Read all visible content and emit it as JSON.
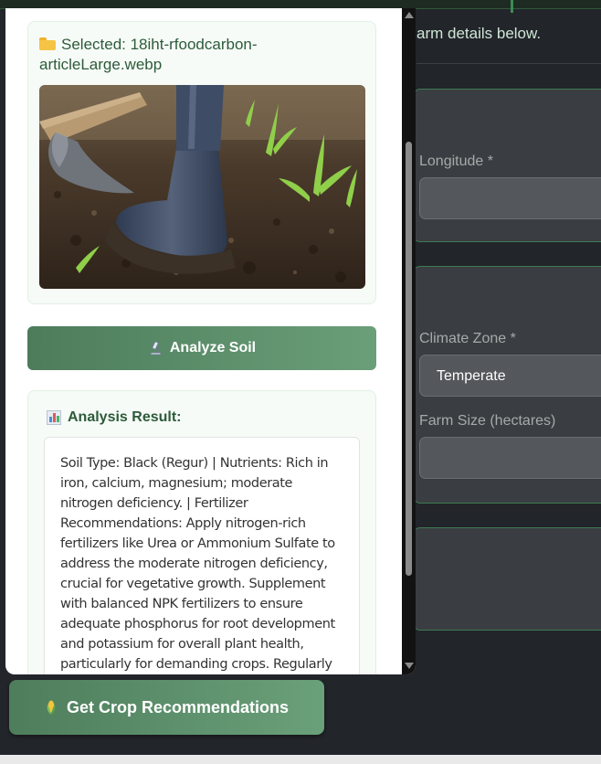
{
  "background_page": {
    "subtitle": "arm details below.",
    "fields": {
      "longitude_label": "Longitude *",
      "longitude_value": "",
      "climate_zone_label": "Climate Zone *",
      "climate_zone_value": "Temperate",
      "farm_size_label": "Farm Size (hectares)",
      "farm_size_value": ""
    },
    "get_crops_button": {
      "icon": "corn-icon",
      "label": "Get Crop Recommendations"
    }
  },
  "soil_modal": {
    "selected_file": {
      "icon": "folder-icon",
      "text": "Selected: 18iht-rfoodcarbon-articleLarge.webp"
    },
    "analyze_button": {
      "icon": "microscope-icon",
      "label": "Analyze Soil"
    },
    "result": {
      "icon": "bar-chart-icon",
      "title": "Analysis Result:",
      "text": "Soil Type: Black (Regur) | Nutrients: Rich in iron, calcium, magnesium; moderate nitrogen deficiency. | Fertilizer Recommendations: Apply nitrogen-rich fertilizers like Urea or Ammonium Sulfate to address the moderate nitrogen deficiency, crucial for vegetative growth. Supplement with balanced NPK fertilizers to ensure adequate phosphorus for root development and potassium for overall plant health, particularly for demanding crops. Regularly incorporate organic matter such as"
    }
  },
  "colors": {
    "accent_green": "#5b8f69",
    "dark_background": "#22252a",
    "panel_tint": "#f6fbf7",
    "heading_green": "#2d5a3a"
  }
}
